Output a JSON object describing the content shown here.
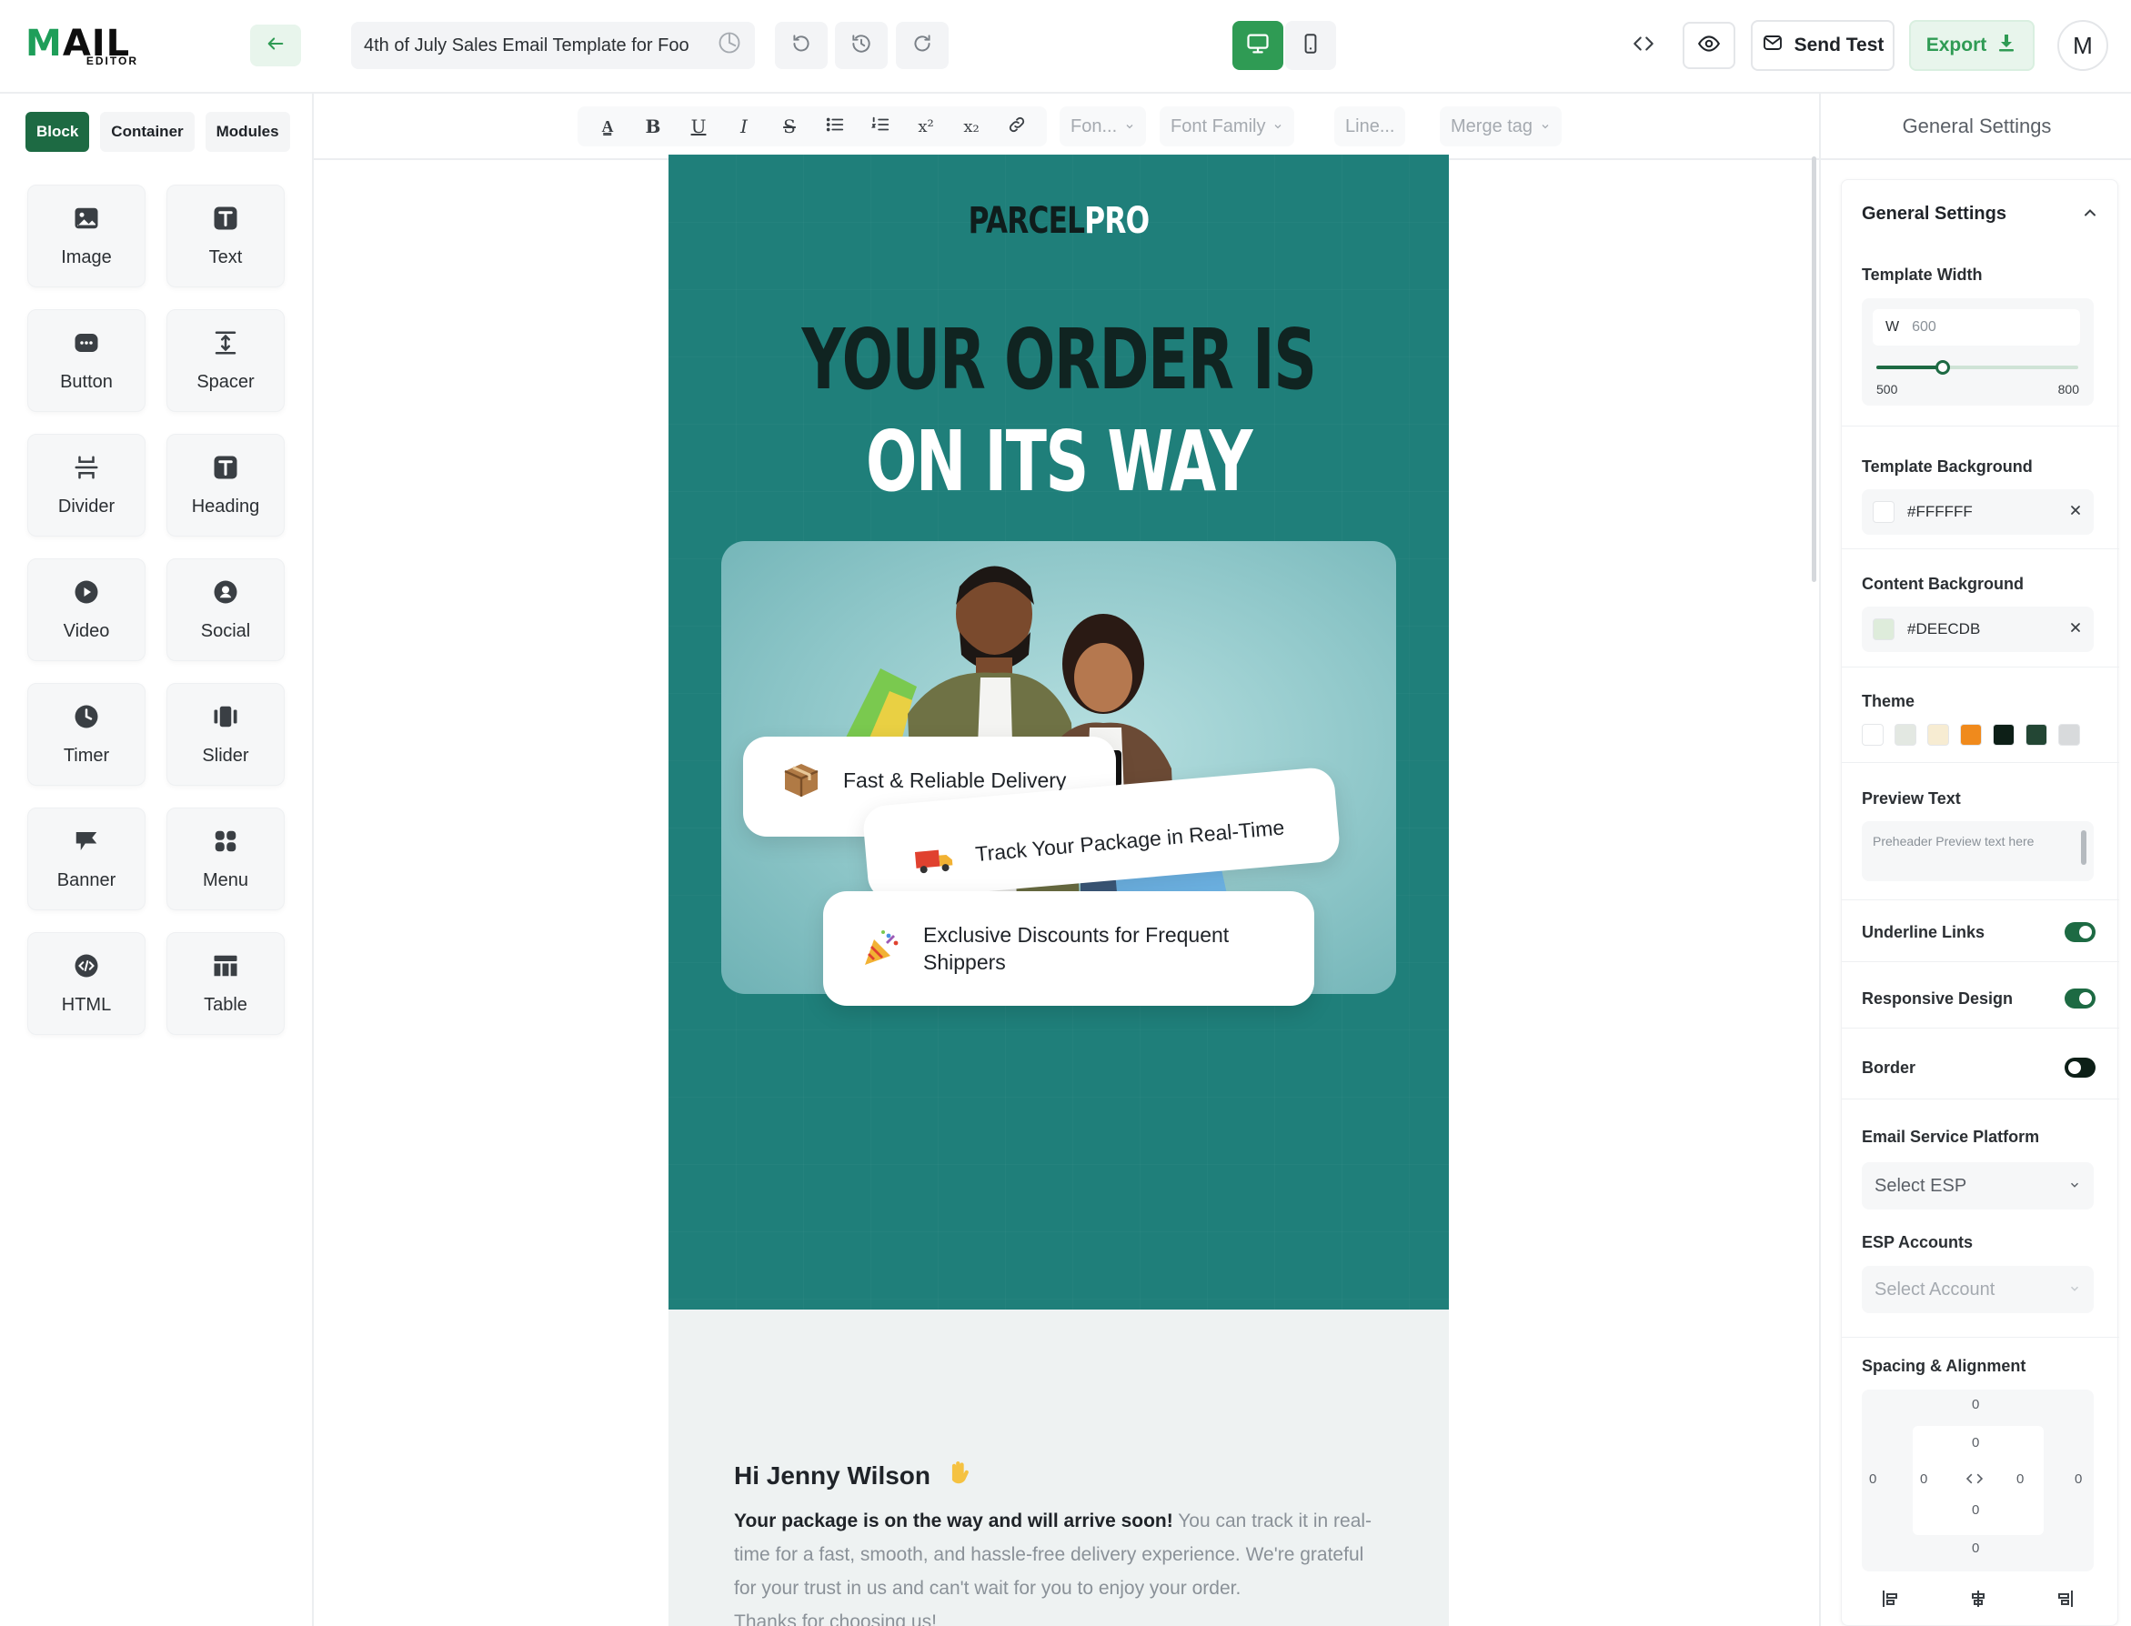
{
  "logo": {
    "main": "MAIL",
    "sub": "EDITOR"
  },
  "header": {
    "template_title": "4th of July Sales Email Template for Foo",
    "send_test_label": "Send Test",
    "export_label": "Export",
    "avatar_initial": "M"
  },
  "sidebar": {
    "tabs": [
      "Block",
      "Container",
      "Modules"
    ],
    "blocks": [
      "Image",
      "Text",
      "Button",
      "Spacer",
      "Divider",
      "Heading",
      "Video",
      "Social",
      "Timer",
      "Slider",
      "Banner",
      "Menu",
      "HTML",
      "Table"
    ]
  },
  "toolbar": {
    "font_size": "Fon...",
    "font_family": "Font Family",
    "line_height": "Line...",
    "merge_tag": "Merge tag"
  },
  "email": {
    "brand_a": "PARCEL",
    "brand_b": "PRO",
    "headline_1": "YOUR ORDER IS",
    "headline_2": "ON ITS WAY",
    "features": [
      "Fast & Reliable Delivery",
      "Track Your Package in Real-Time",
      "Exclusive Discounts for Frequent Shippers"
    ],
    "greeting": "Hi Jenny Wilson",
    "body_bold": "Your package is on the way and will arrive soon!",
    "body_rest": " You can track it in real-time for a fast, smooth, and hassle-free delivery experience. We're grateful for your trust in us and can't wait for you to enjoy your order.",
    "body_cut": "Thanks for choosing us!"
  },
  "settings": {
    "panel_title": "General Settings",
    "section_title": "General Settings",
    "template_width": {
      "label": "Template Width",
      "prefix": "W",
      "value": "600",
      "min": "500",
      "max": "800",
      "level": 0.33
    },
    "template_background": {
      "label": "Template Background",
      "value": "#FFFFFF"
    },
    "content_background": {
      "label": "Content Background",
      "value": "#DEECDB"
    },
    "theme": {
      "label": "Theme",
      "colors": [
        "#ffffff",
        "#e3e8e2",
        "#f7ecd2",
        "#f08a1c",
        "#0d1f17",
        "#234634",
        "#d8dadc"
      ]
    },
    "preview_text": {
      "label": "Preview Text",
      "placeholder": "Preheader Preview text here"
    },
    "underline_links": {
      "label": "Underline Links",
      "on": true
    },
    "responsive_design": {
      "label": "Responsive Design",
      "on": true
    },
    "border": {
      "label": "Border",
      "on": false
    },
    "esp": {
      "label": "Email Service Platform",
      "placeholder": "Select ESP"
    },
    "esp_accounts": {
      "label": "ESP Accounts",
      "placeholder": "Select Account"
    },
    "spacing": {
      "label": "Spacing & Alignment",
      "values": [
        "0",
        "0",
        "0",
        "0",
        "0",
        "0",
        "0",
        "0",
        "0"
      ]
    }
  },
  "colors": {
    "accent": "#2f9b54",
    "dark_accent": "#1d6a43",
    "hero_bg": "#1f7f7a"
  }
}
